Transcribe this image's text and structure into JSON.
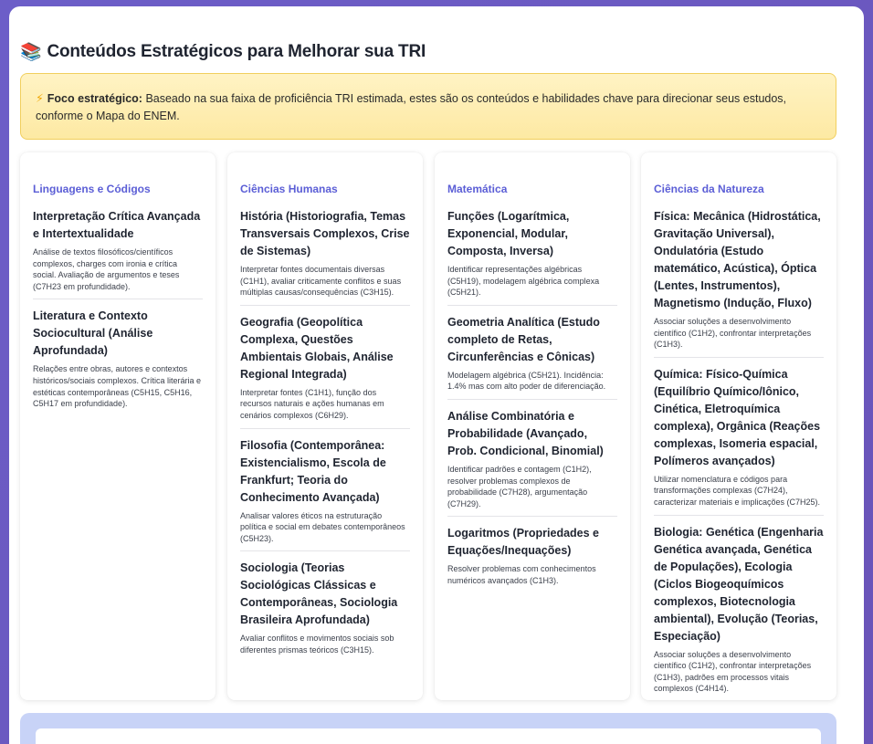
{
  "header": {
    "icon": "books-icon",
    "icon_glyph": "📚",
    "title": "Conteúdos Estratégicos para Melhorar sua TRI"
  },
  "notice": {
    "icon": "lightning-icon",
    "icon_glyph": "⚡",
    "label": "Foco estratégico:",
    "text": " Baseado na sua faixa de proficiência TRI estimada, estes são os conteúdos e habilidades chave para direcionar seus estudos, conforme o Mapa do ENEM."
  },
  "columns": [
    {
      "title": "Linguagens e Códigos",
      "items": [
        {
          "title": "Interpretação Crítica Avançada e Intertextualidade",
          "desc": "Análise de textos filosóficos/científicos complexos, charges com ironia e crítica social. Avaliação de argumentos e teses (C7H23 em profundidade)."
        },
        {
          "title": "Literatura e Contexto Sociocultural (Análise Aprofundada)",
          "desc": "Relações entre obras, autores e contextos históricos/sociais complexos. Crítica literária e estéticas contemporâneas (C5H15, C5H16, C5H17 em profundidade)."
        }
      ]
    },
    {
      "title": "Ciências Humanas",
      "items": [
        {
          "title": "História (Historiografia, Temas Transversais Complexos, Crise de Sistemas)",
          "desc": "Interpretar fontes documentais diversas (C1H1), avaliar criticamente conflitos e suas múltiplas causas/consequências (C3H15)."
        },
        {
          "title": "Geografia (Geopolítica Complexa, Questões Ambientais Globais, Análise Regional Integrada)",
          "desc": "Interpretar fontes (C1H1), função dos recursos naturais e ações humanas em cenários complexos (C6H29)."
        },
        {
          "title": "Filosofia (Contemporânea: Existencialismo, Escola de Frankfurt; Teoria do Conhecimento Avançada)",
          "desc": "Analisar valores éticos na estruturação política e social em debates contemporâneos (C5H23)."
        },
        {
          "title": "Sociologia (Teorias Sociológicas Clássicas e Contemporâneas, Sociologia Brasileira Aprofundada)",
          "desc": "Avaliar conflitos e movimentos sociais sob diferentes prismas teóricos (C3H15)."
        }
      ]
    },
    {
      "title": "Matemática",
      "items": [
        {
          "title": "Funções (Logarítmica, Exponencial, Modular, Composta, Inversa)",
          "desc": "Identificar representações algébricas (C5H19), modelagem algébrica complexa (C5H21)."
        },
        {
          "title": "Geometria Analítica (Estudo completo de Retas, Circunferências e Cônicas)",
          "desc": "Modelagem algébrica (C5H21). Incidência: 1.4% mas com alto poder de diferenciação."
        },
        {
          "title": "Análise Combinatória e Probabilidade (Avançado, Prob. Condicional, Binomial)",
          "desc": "Identificar padrões e contagem (C1H2), resolver problemas complexos de probabilidade (C7H28), argumentação (C7H29)."
        },
        {
          "title": "Logaritmos (Propriedades e Equações/Inequações)",
          "desc": "Resolver problemas com conhecimentos numéricos avançados (C1H3)."
        }
      ]
    },
    {
      "title": "Ciências da Natureza",
      "items": [
        {
          "title": "Física: Mecânica (Hidrostática, Gravitação Universal), Ondulatória (Estudo matemático, Acústica), Óptica (Lentes, Instrumentos), Magnetismo (Indução, Fluxo)",
          "desc": "Associar soluções a desenvolvimento científico (C1H2), confrontar interpretações (C1H3)."
        },
        {
          "title": "Química: Físico-Química (Equilíbrio Químico/Iônico, Cinética, Eletroquímica complexa), Orgânica (Reações complexas, Isomeria espacial, Polímeros avançados)",
          "desc": "Utilizar nomenclatura e códigos para transformações complexas (C7H24), caracterizar materiais e implicações (C7H25)."
        },
        {
          "title": "Biologia: Genética (Engenharia Genética avançada, Genética de Populações), Ecologia (Ciclos Biogeoquímicos complexos, Biotecnologia ambiental), Evolução (Teorias, Especiação)",
          "desc": "Associar soluções a desenvolvimento científico (C1H2), confrontar interpretações (C1H3), padrões em processos vitais complexos (C4H14)."
        }
      ]
    }
  ]
}
